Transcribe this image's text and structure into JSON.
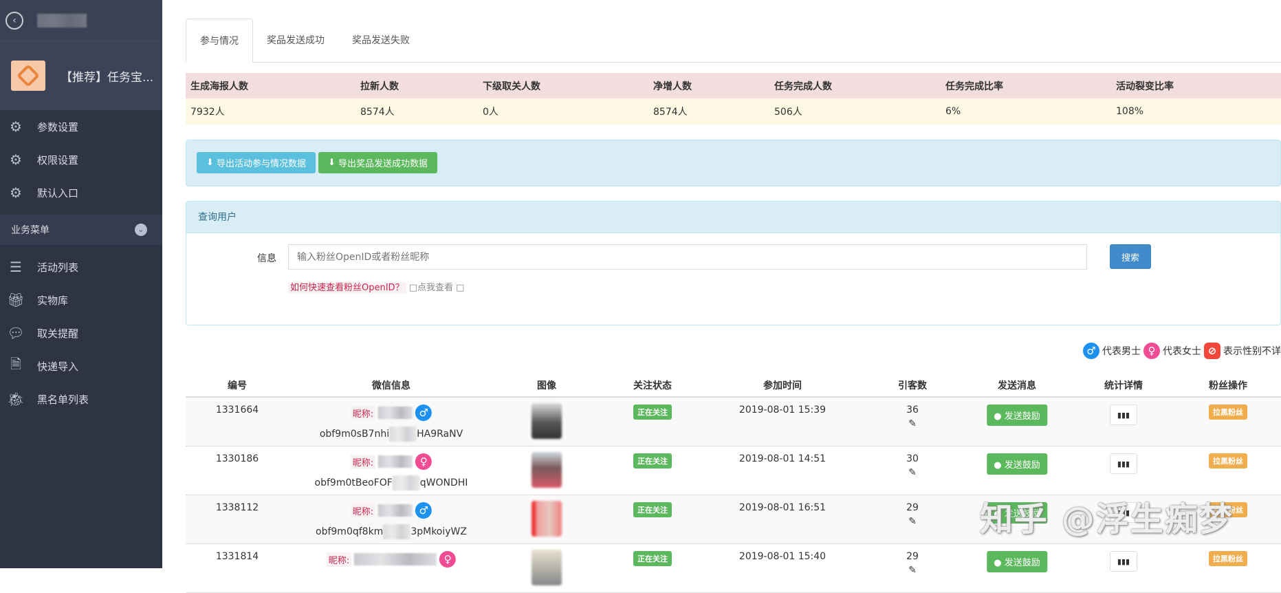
{
  "sidebar": {
    "back_icon": "chevron-left-circle-icon",
    "app_name": "【推荐】任务宝...",
    "items_top": [
      {
        "label": "参数设置",
        "icon": "gear-icon"
      },
      {
        "label": "权限设置",
        "icon": "gear-icon"
      },
      {
        "label": "默认入口",
        "icon": "gear-icon"
      }
    ],
    "section": "业务菜单",
    "items": [
      {
        "label": "活动列表",
        "icon": "list-icon"
      },
      {
        "label": "实物库",
        "icon": "gift-icon"
      },
      {
        "label": "取关提醒",
        "icon": "comments-icon"
      },
      {
        "label": "快递导入",
        "icon": "file-icon"
      },
      {
        "label": "黑名单列表",
        "icon": "bug-icon"
      }
    ]
  },
  "tabs": [
    "参与情况",
    "奖品发送成功",
    "奖品发送失败"
  ],
  "stats": {
    "headers": [
      "生成海报人数",
      "拉新人数",
      "下级取关人数",
      "净增人数",
      "任务完成人数",
      "任务完成比率",
      "活动裂变比率"
    ],
    "values": [
      "7932人",
      "8574人",
      "0人",
      "8574人",
      "506人",
      "6%",
      "108%"
    ]
  },
  "export": {
    "btn1": "导出活动参与情况数据",
    "btn2": "导出奖品发送成功数据"
  },
  "query": {
    "title": "查询用户",
    "label": "信息",
    "placeholder": "输入粉丝OpenID或者粉丝昵称",
    "search": "搜索",
    "help": "如何快速查看粉丝OpenID？",
    "help_link": "□点我查看 □"
  },
  "legend": {
    "male": "代表男士",
    "female": "代表女士",
    "unknown": "表示性别不详"
  },
  "table": {
    "headers": [
      "编号",
      "微信信息",
      "图像",
      "关注状态",
      "参加时间",
      "引客数",
      "发送消息",
      "统计详情",
      "粉丝操作"
    ],
    "nick_label": "昵称:",
    "send_label": "发送鼓励",
    "block_label": "拉黑粉丝",
    "rows": [
      {
        "id": "1331664",
        "gender": "male",
        "openid_a": "obf9m0sB7nhi",
        "openid_b": "HA9RaNV",
        "status": "正在关注",
        "time": "2019-08-01 15:39",
        "count": "36"
      },
      {
        "id": "1330186",
        "gender": "female",
        "openid_a": "obf9m0tBeoFOF",
        "openid_b": "qWONDHI",
        "status": "正在关注",
        "time": "2019-08-01 14:51",
        "count": "30"
      },
      {
        "id": "1338112",
        "gender": "male",
        "openid_a": "obf9m0qf8km",
        "openid_b": "3pMkoiyWZ",
        "status": "正在关注",
        "time": "2019-08-01 16:51",
        "count": "29"
      },
      {
        "id": "1331814",
        "gender": "female",
        "openid_a": "",
        "openid_b": "",
        "status": "正在关注",
        "time": "2019-08-01 15:40",
        "count": "29"
      }
    ]
  },
  "watermark": "知乎 @浮生痴梦",
  "colors": {
    "sidebar": "#2f3445",
    "success": "#5cb85c",
    "info": "#5bc0de",
    "primary": "#428bca",
    "warning": "#f0ad4e"
  }
}
